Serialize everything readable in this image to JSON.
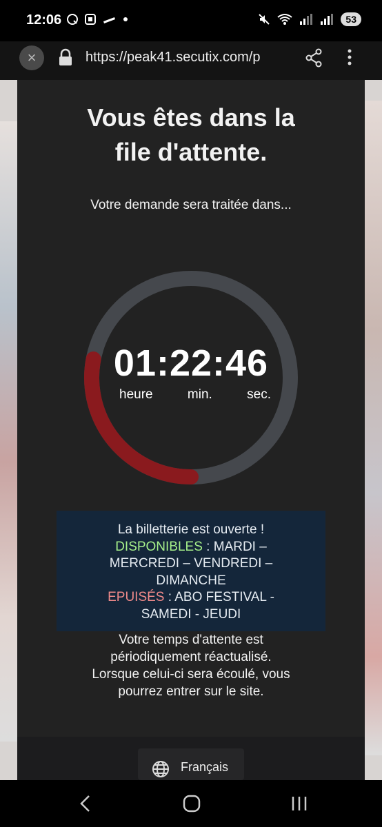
{
  "status_bar": {
    "time": "12:06",
    "battery": "53"
  },
  "browser": {
    "url": "https://peak41.secutix.com/p"
  },
  "queue": {
    "title_line1": "Vous êtes dans la",
    "title_line2": "file d'attente.",
    "subtitle": "Votre demande sera traitée dans...",
    "timer": "01:22:46",
    "labels": {
      "hours": "heure",
      "minutes": "min.",
      "seconds": "sec."
    },
    "progress_fraction": 0.28,
    "colors": {
      "ring_track": "#45484d",
      "ring_progress": "#8a1a1e",
      "notice_bg": "#14263a"
    }
  },
  "notice": {
    "line1": "La billetterie est ouverte !",
    "available_label": "DISPONIBLES",
    "available_text_1": " :  MARDI –",
    "available_text_2": "MERCREDI – VENDREDI –",
    "available_text_3": "DIMANCHE",
    "soldout_label": "EPUISÉS",
    "soldout_text_1": " : ABO FESTIVAL -",
    "soldout_text_2": "SAMEDI  - JEUDI"
  },
  "info": {
    "line1": "Votre temps d'attente est",
    "line2": "périodiquement réactualisé.",
    "line3": "Lorsque celui-ci sera écoulé, vous",
    "line4": "pourrez entrer sur le site."
  },
  "footer": {
    "language": "Français"
  }
}
